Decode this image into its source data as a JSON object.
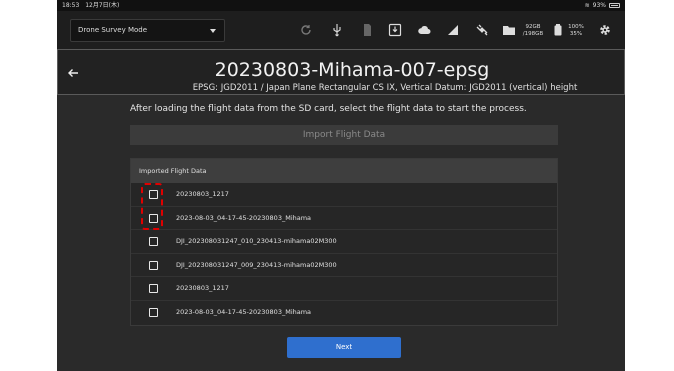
{
  "statusbar": {
    "time": "18:53",
    "date": "12月7日(木)",
    "battery": "93%"
  },
  "toolbar": {
    "mode": "Drone Survey Mode",
    "storage_used": "92GB",
    "storage_total": "/198GB",
    "battery_top": "100%",
    "battery_bottom": "35%"
  },
  "header": {
    "title": "20230803-Mihama-007-epsg",
    "subtitle": "EPSG: JGD2011 / Japan Plane Rectangular CS IX, Vertical Datum: JGD2011 (vertical) height"
  },
  "instruction": "After loading the flight data from the SD card, select the flight data to start the process.",
  "import_button": "Import Flight Data",
  "list": {
    "header": "Imported Flight Data",
    "items": [
      {
        "label": "20230803_1217",
        "checked": false
      },
      {
        "label": "2023-08-03_04-17-45-20230803_Mihama",
        "checked": false
      },
      {
        "label": "DJI_202308031247_010_230413-mihama02M300",
        "checked": false
      },
      {
        "label": "DJI_202308031247_009_230413-mihama02M300",
        "checked": false
      },
      {
        "label": "20230803_1217",
        "checked": false
      },
      {
        "label": "2023-08-03_04-17-45-20230803_Mihama",
        "checked": false
      }
    ]
  },
  "next_button": "Next",
  "colors": {
    "accent": "#2f6fce",
    "highlight": "#e00000",
    "background": "#2a2a2a"
  }
}
